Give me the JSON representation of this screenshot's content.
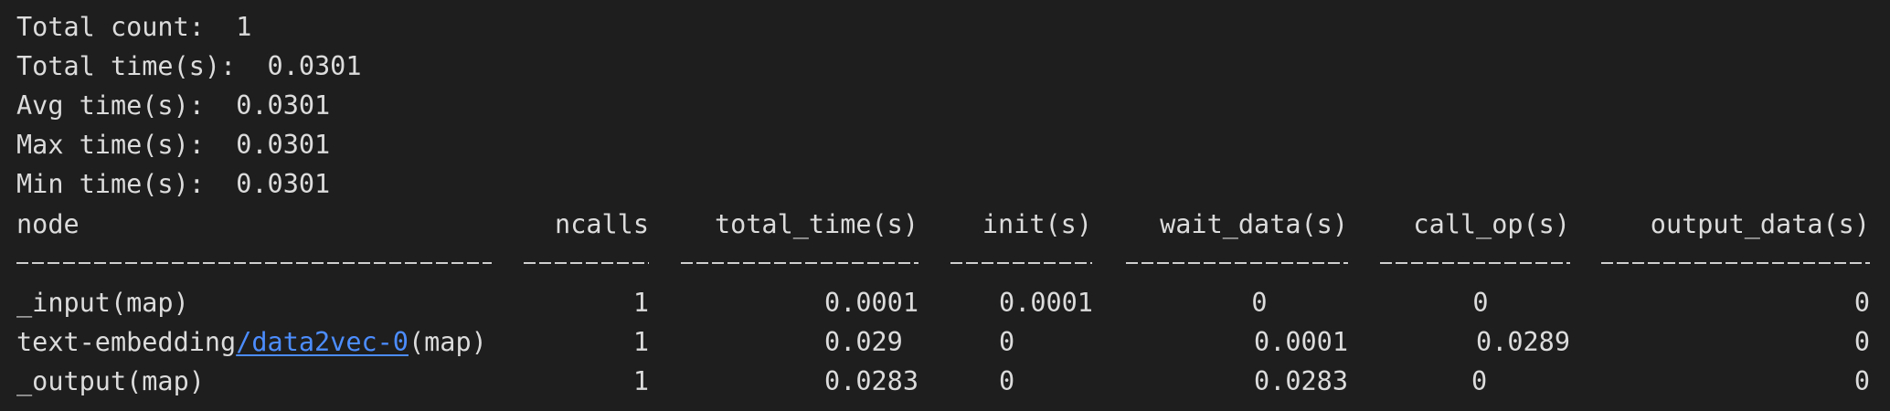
{
  "summary": {
    "total_count_label": "Total count:",
    "total_count_value": "1",
    "total_time_label": "Total time(s):",
    "total_time_value": "0.0301",
    "avg_time_label": "Avg time(s):",
    "avg_time_value": "0.0301",
    "max_time_label": "Max time(s):",
    "max_time_value": "0.0301",
    "min_time_label": "Min time(s):",
    "min_time_value": "0.0301"
  },
  "table": {
    "headers": {
      "node": "node",
      "ncalls": "ncalls",
      "total_time": "total_time(s)",
      "init": "init(s)",
      "wait_data": "wait_data(s)",
      "call_op": "call_op(s)",
      "output_data": "output_data(s)"
    },
    "rows": [
      {
        "node": "_input(map)",
        "ncalls": "1",
        "total_time": "0.0001",
        "init": "0.0001",
        "wait_data": "0",
        "call_op": "0",
        "output_data": "0"
      },
      {
        "node_prefix": "text-embedding",
        "node_link": "/data2vec-0",
        "node_suffix": "(map)",
        "ncalls": "1",
        "total_time": "0.029",
        "init": "0",
        "wait_data": "0.0001",
        "call_op": "0.0289",
        "output_data": "0"
      },
      {
        "node": "_output(map)",
        "ncalls": "1",
        "total_time": "0.0283",
        "init": "0",
        "wait_data": "0.0283",
        "call_op": "0",
        "output_data": "0"
      }
    ]
  },
  "colors": {
    "background": "#1e1e1e",
    "text": "#dcdcdc",
    "link": "#4c8dff"
  }
}
